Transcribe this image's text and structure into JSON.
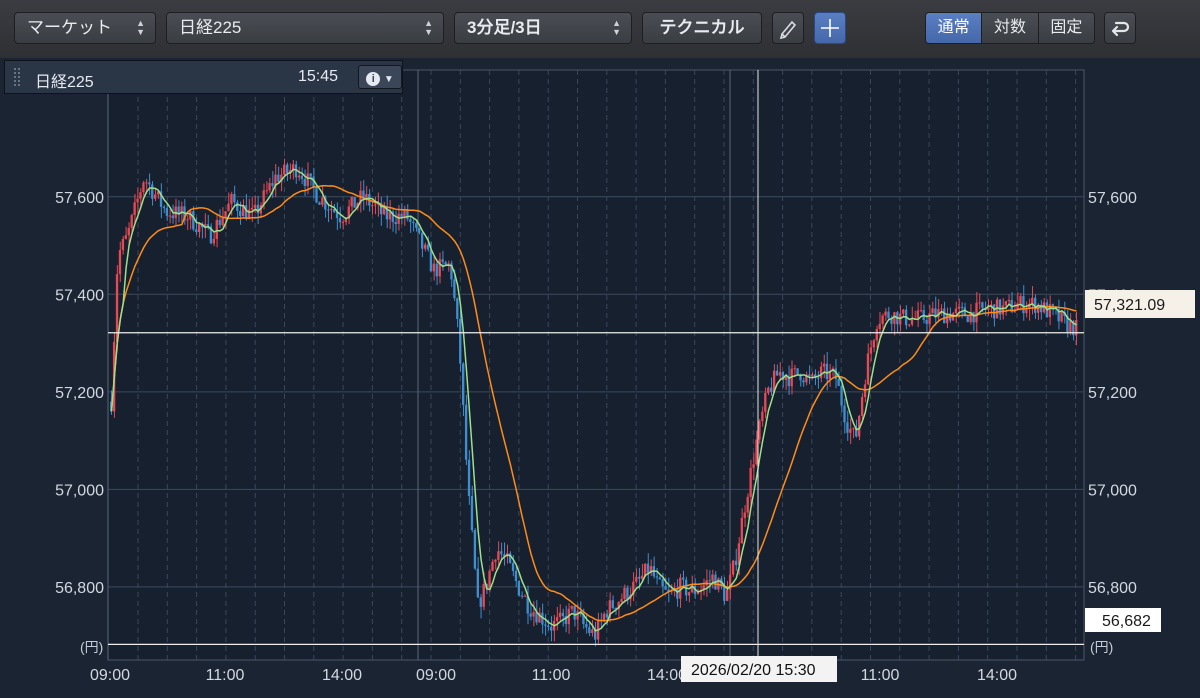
{
  "toolbar": {
    "market_label": "マーケット",
    "symbol_label": "日経225",
    "interval_label": "3分足/3日",
    "technical_label": "テクニカル",
    "scale_modes": [
      "通常",
      "対数",
      "固定"
    ],
    "active_scale_mode": "通常",
    "active_color": "#4a6fb4"
  },
  "info": {
    "symbol": "日経225",
    "time": "15:45",
    "info_icon": "i"
  },
  "chart_data": {
    "type": "candlestick",
    "x_tick_labels": [
      "09:00",
      "11:00",
      "14:00",
      "09:00",
      "11:00",
      "14:00",
      "09:00",
      "11:00",
      "14:00"
    ],
    "y_ticks": [
      56800,
      57000,
      57200,
      57400,
      57600
    ],
    "y_tick_labels": [
      "56,800",
      "57,000",
      "57,200",
      "57,400",
      "57,600"
    ],
    "ylim": [
      56650,
      57860
    ],
    "y_unit": "(円)",
    "crosshair_value": 57321.09,
    "crosshair_value_label": "57,321.09",
    "crosshair_time_label": "2026/02/20 15:30",
    "low_line_value": 56682,
    "low_line_label": "56,682",
    "colors": {
      "up": "#e84a55",
      "down": "#3f8fd0",
      "ma_short": "#9fe08a",
      "ma_long": "#ff8c1a",
      "grid": "#3b4a60"
    },
    "path_keypoints": [
      [
        0,
        57180
      ],
      [
        6,
        57480
      ],
      [
        15,
        57520
      ],
      [
        30,
        57640
      ],
      [
        50,
        57570
      ],
      [
        70,
        57560
      ],
      [
        90,
        57520
      ],
      [
        110,
        57590
      ],
      [
        130,
        57560
      ],
      [
        150,
        57640
      ],
      [
        170,
        57660
      ],
      [
        190,
        57600
      ],
      [
        210,
        57560
      ],
      [
        230,
        57600
      ],
      [
        250,
        57560
      ],
      [
        270,
        57560
      ],
      [
        295,
        57450
      ],
      [
        310,
        57460
      ],
      [
        318,
        57300
      ],
      [
        326,
        57000
      ],
      [
        335,
        56760
      ],
      [
        342,
        56800
      ],
      [
        352,
        56880
      ],
      [
        362,
        56850
      ],
      [
        372,
        56800
      ],
      [
        382,
        56760
      ],
      [
        392,
        56740
      ],
      [
        402,
        56720
      ],
      [
        412,
        56730
      ],
      [
        422,
        56750
      ],
      [
        432,
        56720
      ],
      [
        442,
        56700
      ],
      [
        452,
        56750
      ],
      [
        462,
        56770
      ],
      [
        472,
        56790
      ],
      [
        482,
        56810
      ],
      [
        492,
        56840
      ],
      [
        500,
        56800
      ],
      [
        510,
        56780
      ],
      [
        520,
        56800
      ],
      [
        530,
        56790
      ],
      [
        540,
        56800
      ],
      [
        550,
        56820
      ],
      [
        562,
        56780
      ],
      [
        570,
        56850
      ],
      [
        580,
        56980
      ],
      [
        590,
        57100
      ],
      [
        600,
        57200
      ],
      [
        610,
        57240
      ],
      [
        620,
        57230
      ],
      [
        630,
        57240
      ],
      [
        640,
        57220
      ],
      [
        650,
        57240
      ],
      [
        662,
        57230
      ],
      [
        672,
        57140
      ],
      [
        680,
        57100
      ],
      [
        690,
        57250
      ],
      [
        700,
        57350
      ],
      [
        712,
        57360
      ],
      [
        725,
        57350
      ],
      [
        740,
        57350
      ],
      [
        755,
        57360
      ],
      [
        770,
        57360
      ],
      [
        785,
        57360
      ],
      [
        800,
        57370
      ],
      [
        815,
        57370
      ],
      [
        830,
        57380
      ],
      [
        845,
        57380
      ],
      [
        860,
        57360
      ],
      [
        872,
        57340
      ],
      [
        882,
        57330
      ]
    ]
  }
}
